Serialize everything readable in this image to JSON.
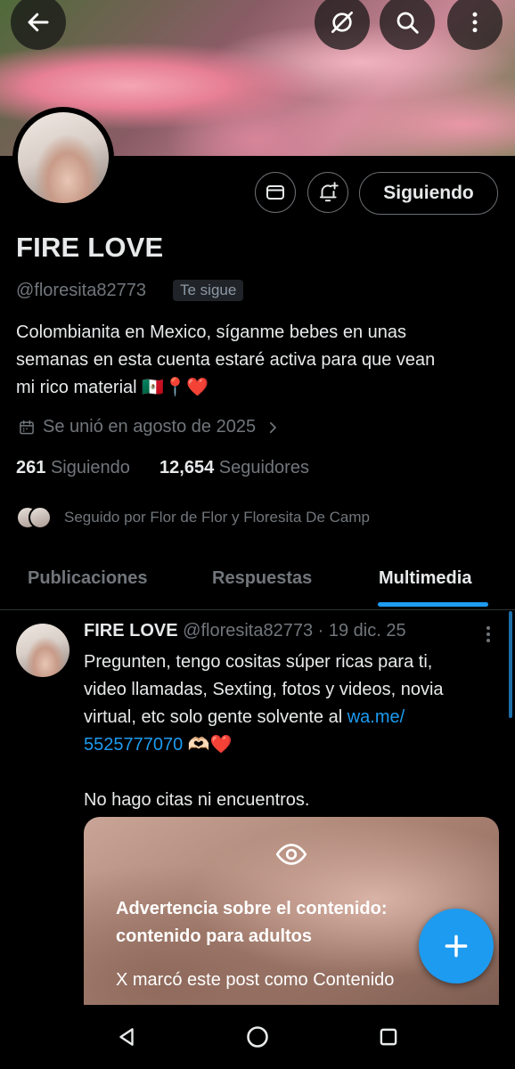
{
  "profile": {
    "name": "FIRE LOVE",
    "handle": "@floresita82773",
    "follows_you_badge": "Te sigue",
    "bio_line1": "Colombianita en  Mexico, síganme bebes en unas",
    "bio_line2": "semanas en esta cuenta estaré activa para que vean",
    "bio_line3": "mi rico material 🇲🇽📍❤️",
    "joined": "Se unió en agosto de 2025",
    "following_count": "261",
    "following_label": "Siguiendo",
    "followers_count": "12,654",
    "followers_label": "Seguidores",
    "followed_by": "Seguido por Flor de Flor y Floresita De Camp"
  },
  "actions": {
    "follow_state_label": "Siguiendo"
  },
  "tabs": [
    {
      "label": "Publicaciones",
      "active": false
    },
    {
      "label": "Respuestas",
      "active": false
    },
    {
      "label": "Multimedia",
      "active": true
    }
  ],
  "post": {
    "author_name": "FIRE LOVE",
    "author_handle": "@floresita82773",
    "date": "· 19 dic. 25",
    "text_line1": "Pregunten, tengo cositas súper ricas para ti,",
    "text_line2": "video llamadas, Sexting, fotos y videos, novia",
    "text_line3_prefix": "virtual, etc solo gente solvente al ",
    "link_part1": "wa.me/",
    "link_part2": "5525777070",
    "text_line4_suffix": " 🫶🏻❤️",
    "text_line6": "No hago citas ni encuentros.",
    "warning_title": "Advertencia sobre el contenido: contenido para adultos",
    "warning_subtitle": "X marcó este post como Contenido"
  },
  "icons": {
    "back": "arrow-left-icon",
    "grok": "grok-icon",
    "search": "search-icon",
    "more": "more-vertical-icon",
    "message": "mail-icon",
    "notify": "bell-plus-icon",
    "calendar": "calendar-icon",
    "chevron": "chevron-right-icon",
    "eye": "eye-icon",
    "compose": "plus-icon"
  },
  "colors": {
    "accent": "#1d9bf0",
    "background": "#000000",
    "text_primary": "#e7e9ea",
    "text_secondary": "#71767b"
  }
}
